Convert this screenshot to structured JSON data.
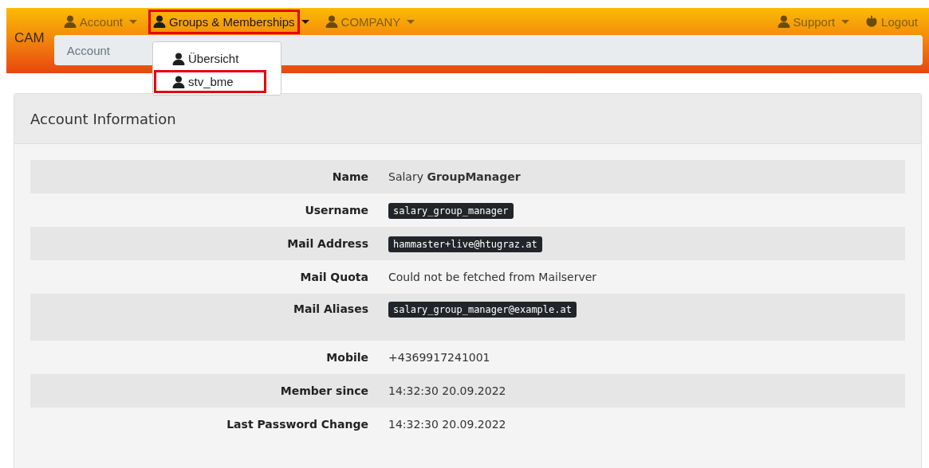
{
  "navbar": {
    "brand": "CAM",
    "menu_left": [
      {
        "label": "Account",
        "kind": "dropdown",
        "selected": false,
        "highlighted": false
      },
      {
        "label": "Groups & Memberships",
        "kind": "dropdown",
        "selected": true,
        "highlighted": true
      },
      {
        "label": "COMPANY",
        "kind": "dropdown",
        "selected": false,
        "highlighted": false
      }
    ],
    "menu_right": [
      {
        "label": "Support",
        "kind": "dropdown",
        "selected": false,
        "highlighted": false
      },
      {
        "label": "Logout",
        "kind": "logout",
        "selected": false,
        "highlighted": false
      }
    ],
    "dropdown": [
      {
        "label": "Übersicht",
        "highlighted": false
      },
      {
        "label": "stv_bme",
        "highlighted": true
      }
    ],
    "breadcrumb": [
      "Account"
    ]
  },
  "card": {
    "title": "Account Information",
    "rows": [
      {
        "label": "Name",
        "value": "Salary **GroupManager**",
        "kind": "text"
      },
      {
        "label": "Username",
        "value": "salary_group_manager",
        "kind": "code"
      },
      {
        "label": "Mail Address",
        "value": "hammaster+live@htugraz.at",
        "kind": "code"
      },
      {
        "label": "Mail Quota",
        "value": "Could not be fetched from Mailserver",
        "kind": "text"
      },
      {
        "label": "Mail Aliases",
        "value": "salary_group_manager@example.at",
        "kind": "code_list"
      },
      {
        "label": "Mobile",
        "value": "+4369917241001",
        "kind": "text"
      },
      {
        "label": "Member since",
        "value": "14:32:30 20.09.2022",
        "kind": "text"
      },
      {
        "label": "Last Password Change",
        "value": "14:32:30 20.09.2022",
        "kind": "text"
      }
    ]
  }
}
